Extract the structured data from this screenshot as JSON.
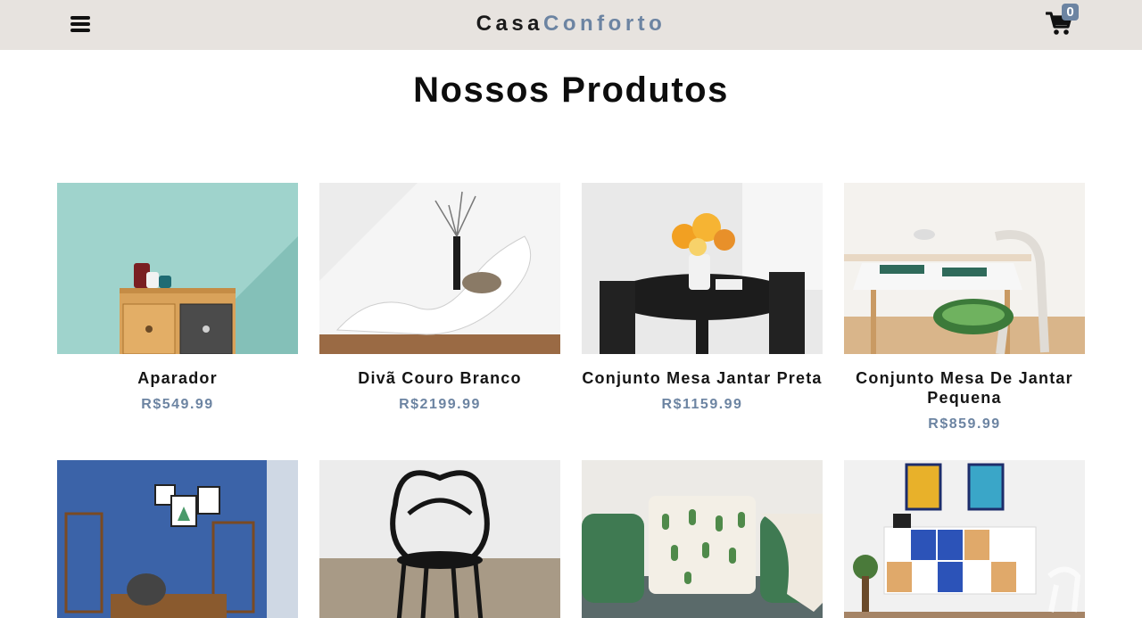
{
  "navbar": {
    "brand_part1": "Casa",
    "brand_part2": "Conforto",
    "cart_count": "0",
    "menu_icon": "bars-icon",
    "cart_icon": "shopping-cart-icon"
  },
  "section": {
    "title": "Nossos Produtos"
  },
  "products": [
    {
      "name": "Aparador",
      "price": "R$549.99"
    },
    {
      "name": "Divã Couro Branco",
      "price": "R$2199.99"
    },
    {
      "name": "Conjunto Mesa Jantar Preta",
      "price": "R$1159.99"
    },
    {
      "name": "Conjunto Mesa De Jantar Pequena",
      "price": "R$859.99"
    },
    {
      "name": "",
      "price": ""
    },
    {
      "name": "",
      "price": ""
    },
    {
      "name": "",
      "price": ""
    },
    {
      "name": "",
      "price": ""
    }
  ],
  "colors": {
    "navbar_bg": "#e7e3df",
    "accent": "#6c84a2",
    "text": "#111111"
  }
}
